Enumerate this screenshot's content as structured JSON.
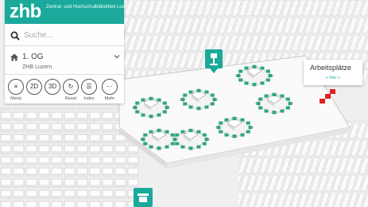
{
  "brand": {
    "logo": "zhb",
    "subtitle": "Zentral- und Hochschulbibliothek Luzern",
    "color": "#1aa99b"
  },
  "search": {
    "placeholder": "Suche..."
  },
  "floor": {
    "label": "1. OG",
    "building": "ZHB Luzern"
  },
  "tools": [
    {
      "icon": "menu-icon",
      "glyph": "≡",
      "label": "Menü"
    },
    {
      "icon": "view-2d-icon",
      "glyph": "2D",
      "label": ""
    },
    {
      "icon": "view-3d-icon",
      "glyph": "3D",
      "label": ""
    },
    {
      "icon": "reset-icon",
      "glyph": "↻",
      "label": "Reset"
    },
    {
      "icon": "index-icon",
      "glyph": "☰",
      "label": "Index"
    },
    {
      "icon": "more-icon",
      "glyph": "···",
      "label": "Mehr"
    }
  ],
  "popup": {
    "title": "Arbeitsplätze",
    "link": "« hier »"
  },
  "colors": {
    "accent": "#1aa99b",
    "desk": "#2fa582",
    "highlight": "#e02020"
  }
}
